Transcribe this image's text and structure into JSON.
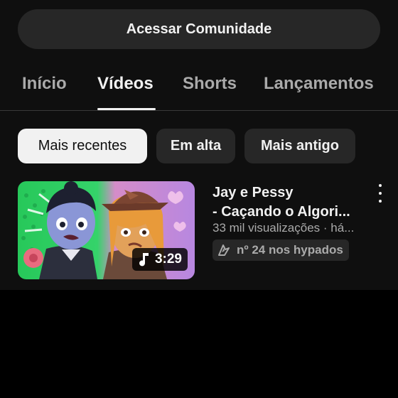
{
  "community_button": {
    "label": "Acessar Comunidade"
  },
  "tabs": [
    {
      "label": "Início",
      "active": false
    },
    {
      "label": "Vídeos",
      "active": true
    },
    {
      "label": "Shorts",
      "active": false
    },
    {
      "label": "Lançamentos",
      "active": false
    }
  ],
  "chips": [
    {
      "label": "Mais recentes",
      "selected": true
    },
    {
      "label": "Em alta",
      "selected": false
    },
    {
      "label": "Mais antigo",
      "selected": false
    }
  ],
  "video": {
    "title_line1": "Jay e Pessy",
    "title_line2": "- Caçando o Algori...",
    "meta": "33 mil visualizações · há...",
    "badge": "nº 24 nos hypados",
    "duration": "3:29",
    "duration_icon": "music-note-icon",
    "badge_icon": "hype-icon",
    "menu_icon": "more-vert-icon"
  },
  "colors": {
    "background": "#0f0f0f",
    "surface": "#272727",
    "text_primary": "#f1f1f1",
    "text_secondary": "#aaaaaa",
    "chip_selected": "#f1f1f1"
  }
}
